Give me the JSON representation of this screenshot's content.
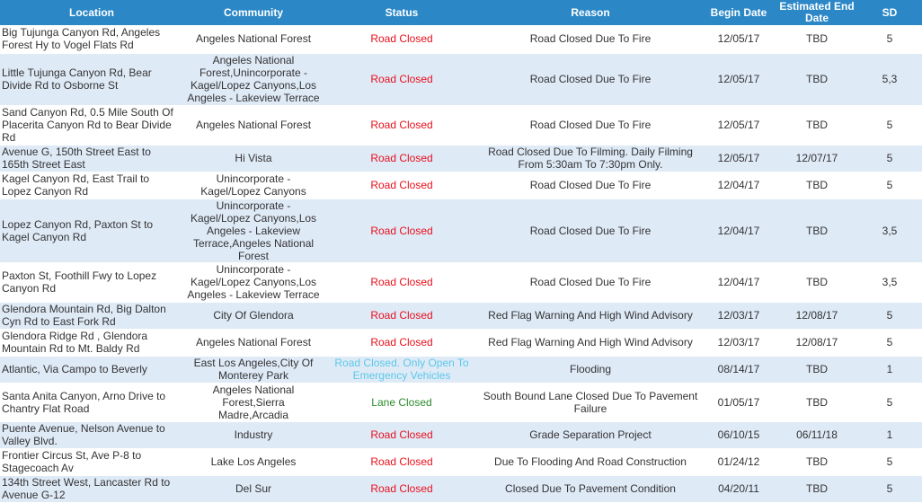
{
  "columns": {
    "location": "Location",
    "community": "Community",
    "status": "Status",
    "reason": "Reason",
    "begin_date": "Begin Date",
    "estimated_end_date": "Estimated End Date",
    "sd": "SD"
  },
  "status_colors": {
    "road_closed": "#e8101c",
    "lane_closed": "#2c8a2c",
    "emergency_only": "#5bc8e8",
    "header_bg": "#2b87c6",
    "alt_row_bg": "#dfeaf7"
  },
  "rows": [
    {
      "location": "Big Tujunga Canyon Rd, Angeles Forest Hy to Vogel Flats Rd",
      "community": "Angeles National Forest",
      "status": "Road Closed",
      "reason": "Road Closed Due To Fire",
      "begin": "12/05/17",
      "end": "TBD",
      "sd": "5"
    },
    {
      "location": "Little Tujunga Canyon Rd, Bear Divide Rd to Osborne St",
      "community": "Angeles National Forest,Unincorporate - Kagel/Lopez Canyons,Los Angeles - Lakeview Terrace",
      "status": "Road Closed",
      "reason": "Road Closed Due To Fire",
      "begin": "12/05/17",
      "end": "TBD",
      "sd": "5,3"
    },
    {
      "location": "Sand Canyon Rd, 0.5 Mile South Of Placerita Canyon Rd to Bear Divide Rd",
      "community": "Angeles National Forest",
      "status": "Road Closed",
      "reason": "Road Closed Due To Fire",
      "begin": "12/05/17",
      "end": "TBD",
      "sd": "5"
    },
    {
      "location": "Avenue G, 150th Street East to 165th Street East",
      "community": "Hi Vista",
      "status": "Road Closed",
      "reason": "Road Closed Due To Filming. Daily Filming From 5:30am To 7:30pm Only.",
      "begin": "12/05/17",
      "end": "12/07/17",
      "sd": "5"
    },
    {
      "location": "Kagel Canyon Rd, East Trail to Lopez Canyon Rd",
      "community": "Unincorporate - Kagel/Lopez Canyons",
      "status": "Road Closed",
      "reason": "Road Closed Due To Fire",
      "begin": "12/04/17",
      "end": "TBD",
      "sd": "5"
    },
    {
      "location": "Lopez Canyon Rd, Paxton St to Kagel Canyon Rd",
      "community": "Unincorporate - Kagel/Lopez Canyons,Los Angeles - Lakeview Terrace,Angeles National Forest",
      "status": "Road Closed",
      "reason": "Road Closed Due To Fire",
      "begin": "12/04/17",
      "end": "TBD",
      "sd": "3,5"
    },
    {
      "location": "Paxton St, Foothill Fwy to Lopez Canyon Rd",
      "community": "Unincorporate - Kagel/Lopez Canyons,Los Angeles - Lakeview Terrace",
      "status": "Road Closed",
      "reason": "Road Closed Due To Fire",
      "begin": "12/04/17",
      "end": "TBD",
      "sd": "3,5"
    },
    {
      "location": "Glendora Mountain Rd, Big Dalton Cyn Rd to East Fork Rd",
      "community": "City Of Glendora",
      "status": "Road Closed",
      "reason": "Red Flag Warning And High Wind Advisory",
      "begin": "12/03/17",
      "end": "12/08/17",
      "sd": "5"
    },
    {
      "location": "Glendora Ridge Rd , Glendora Mountain Rd to Mt. Baldy Rd",
      "community": "Angeles National Forest",
      "status": "Road Closed",
      "reason": "Red Flag Warning And High Wind Advisory",
      "begin": "12/03/17",
      "end": "12/08/17",
      "sd": "5"
    },
    {
      "location": "Atlantic, Via Campo to Beverly",
      "community": "East Los Angeles,City Of Monterey Park",
      "status": "Road Closed. Only Open To Emergency Vehicles",
      "reason": "Flooding",
      "begin": "08/14/17",
      "end": "TBD",
      "sd": "1"
    },
    {
      "location": "Santa Anita Canyon, Arno Drive to Chantry Flat Road",
      "community": "Angeles National Forest,Sierra Madre,Arcadia",
      "status": "Lane Closed",
      "reason": "South Bound Lane Closed Due To Pavement Failure",
      "begin": "01/05/17",
      "end": "TBD",
      "sd": "5"
    },
    {
      "location": "Puente Avenue, Nelson Avenue to Valley Blvd.",
      "community": "Industry",
      "status": "Road Closed",
      "reason": "Grade Separation Project",
      "begin": "06/10/15",
      "end": "06/11/18",
      "sd": "1"
    },
    {
      "location": "Frontier Circus St, Ave P-8 to Stagecoach Av",
      "community": "Lake Los Angeles",
      "status": "Road Closed",
      "reason": "Due To Flooding And Road Construction",
      "begin": "01/24/12",
      "end": "TBD",
      "sd": "5"
    },
    {
      "location": "134th Street West, Lancaster Rd to Avenue G-12",
      "community": "Del Sur",
      "status": "Road Closed",
      "reason": "Closed Due To Pavement Condition",
      "begin": "04/20/11",
      "end": "TBD",
      "sd": "5"
    }
  ]
}
